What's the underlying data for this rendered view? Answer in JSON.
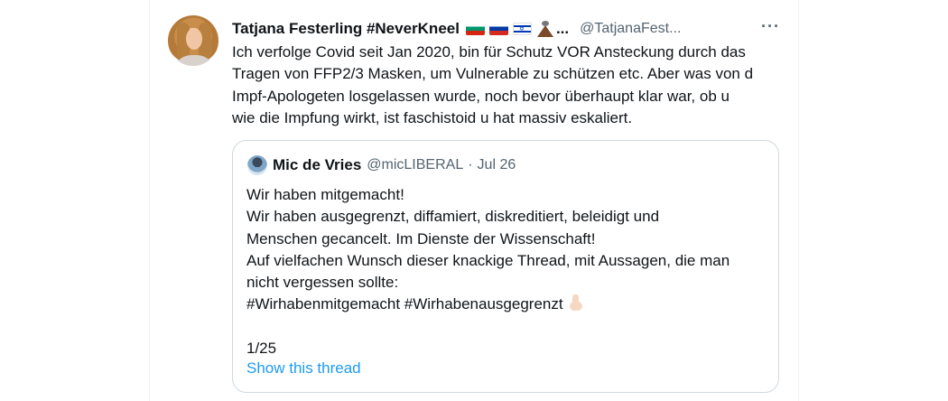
{
  "tweet": {
    "display_name": "Tatjana Festerling #NeverKneel",
    "name_truncation": "...",
    "handle": "@TatjanaFest...",
    "flags": [
      "bulgaria-flag",
      "russia-flag",
      "israel-flag",
      "volcano"
    ],
    "text_lines": [
      "Ich verfolge Covid seit Jan 2020, bin für Schutz VOR Ansteckung durch das",
      "Tragen von FFP2/3 Masken, um Vulnerable zu schützen etc. Aber was von d",
      "Impf-Apologeten losgelassen wurde, noch bevor überhaupt klar war, ob u",
      "wie die Impfung wirkt, ist faschistoid u hat massiv eskaliert."
    ],
    "more_label": "···"
  },
  "quote": {
    "display_name": "Mic de Vries",
    "handle": "@micLIBERAL",
    "separator": "·",
    "date": "Jul 26",
    "text_lines": [
      "Wir haben mitgemacht!",
      "Wir haben ausgegrenzt, diffamiert, diskreditiert, beleidigt und",
      "Menschen gecancelt. Im Dienste der Wissenschaft!",
      "Auf vielfachen Wunsch dieser knackige Thread, mit Aussagen, die man",
      "nicht vergessen sollte:",
      "#Wirhabenmitgemacht #Wirhabenausgegrenzt",
      "",
      "1/25"
    ],
    "show_thread_label": "Show this thread"
  },
  "colors": {
    "text": "#0f1419",
    "secondary": "#536471",
    "link": "#1d9bf0",
    "border": "#cfd9de"
  }
}
